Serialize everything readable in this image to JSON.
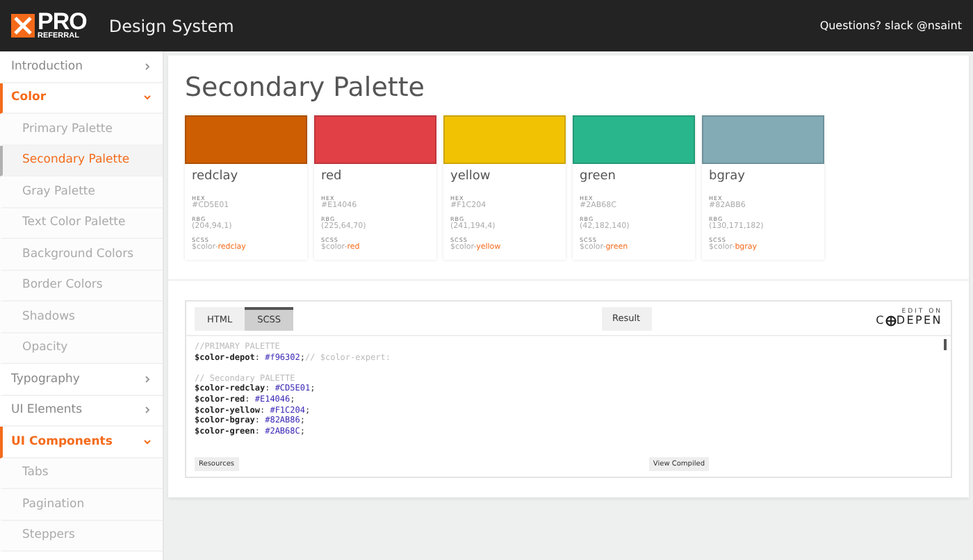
{
  "header": {
    "logo_top": "PRO",
    "logo_bottom": "REFERRAL",
    "title": "Design System",
    "contact": "Questions? slack @nsaint"
  },
  "sidebar": {
    "items": [
      {
        "kind": "section",
        "label": "Introduction",
        "expanded": false
      },
      {
        "kind": "section",
        "label": "Color",
        "expanded": true
      },
      {
        "kind": "sub",
        "label": "Primary Palette",
        "selected": false
      },
      {
        "kind": "sub",
        "label": "Secondary Palette",
        "selected": true
      },
      {
        "kind": "sub",
        "label": "Gray Palette",
        "selected": false
      },
      {
        "kind": "sub",
        "label": "Text Color Palette",
        "selected": false
      },
      {
        "kind": "sub",
        "label": "Background Colors",
        "selected": false
      },
      {
        "kind": "sub",
        "label": "Border Colors",
        "selected": false
      },
      {
        "kind": "sub",
        "label": "Shadows",
        "selected": false
      },
      {
        "kind": "sub",
        "label": "Opacity",
        "selected": false
      },
      {
        "kind": "section",
        "label": "Typography",
        "expanded": false
      },
      {
        "kind": "section",
        "label": "UI Elements",
        "expanded": false
      },
      {
        "kind": "section",
        "label": "UI Components",
        "expanded": true
      },
      {
        "kind": "sub",
        "label": "Tabs",
        "selected": false
      },
      {
        "kind": "sub",
        "label": "Pagination",
        "selected": false
      },
      {
        "kind": "sub",
        "label": "Steppers",
        "selected": false
      }
    ]
  },
  "page": {
    "title": "Secondary Palette",
    "swatches": [
      {
        "name": "redclay",
        "color": "#cd5e01",
        "hex_label": "HEX",
        "hex": "#CD5E01",
        "rgb_label": "RBG",
        "rgb": "(204,94,1)",
        "scss_label": "SCSS",
        "scss_prefix": "$color-",
        "scss_name": "redclay"
      },
      {
        "name": "red",
        "color": "#e14046",
        "hex_label": "HEX",
        "hex": "#E14046",
        "rgb_label": "RBG",
        "rgb": "(225,64,70)",
        "scss_label": "SCSS",
        "scss_prefix": "$color-",
        "scss_name": "red"
      },
      {
        "name": "yellow",
        "color": "#f1c204",
        "hex_label": "HEX",
        "hex": "#F1C204",
        "rgb_label": "RBG",
        "rgb": "(241,194,4)",
        "scss_label": "SCSS",
        "scss_prefix": "$color-",
        "scss_name": "yellow"
      },
      {
        "name": "green",
        "color": "#2ab68c",
        "hex_label": "HEX",
        "hex": "#2AB68C",
        "rgb_label": "RBG",
        "rgb": "(42,182,140)",
        "scss_label": "SCSS",
        "scss_prefix": "$color-",
        "scss_name": "green"
      },
      {
        "name": "bgray",
        "color": "#82abb6",
        "hex_label": "HEX",
        "hex": "#82ABB6",
        "rgb_label": "RBG",
        "rgb": "(130,171,182)",
        "scss_label": "SCSS",
        "scss_prefix": "$color-",
        "scss_name": "bgray"
      }
    ],
    "embed": {
      "tabs": [
        {
          "label": "HTML",
          "selected": false
        },
        {
          "label": "SCSS",
          "selected": true
        }
      ],
      "result_button": "Result",
      "edit_on": "EDIT ON",
      "brand_start": "C",
      "brand_end": "DEPEN",
      "code_blocks": [
        [
          [
            {
              "kind": "comment",
              "text": "//PRIMARY PALETTE"
            }
          ],
          [
            {
              "kind": "var",
              "text": "$color-depot"
            },
            {
              "kind": "plain",
              "text": ": "
            },
            {
              "kind": "value",
              "text": "#f96302"
            },
            {
              "kind": "plain",
              "text": ";"
            },
            {
              "kind": "comment",
              "text": "// $color-expert:"
            }
          ]
        ],
        [
          [
            {
              "kind": "comment",
              "text": "// Secondary PALETTE"
            }
          ],
          [
            {
              "kind": "var",
              "text": "$color-redclay"
            },
            {
              "kind": "plain",
              "text": ": "
            },
            {
              "kind": "value",
              "text": "#CD5E01"
            },
            {
              "kind": "plain",
              "text": ";"
            }
          ],
          [
            {
              "kind": "var",
              "text": "$color-red"
            },
            {
              "kind": "plain",
              "text": ": "
            },
            {
              "kind": "value",
              "text": "#E14046"
            },
            {
              "kind": "plain",
              "text": ";"
            }
          ],
          [
            {
              "kind": "var",
              "text": "$color-yellow"
            },
            {
              "kind": "plain",
              "text": ": "
            },
            {
              "kind": "value",
              "text": "#F1C204"
            },
            {
              "kind": "plain",
              "text": ";"
            }
          ],
          [
            {
              "kind": "var",
              "text": "$color-bgray"
            },
            {
              "kind": "plain",
              "text": ": "
            },
            {
              "kind": "value",
              "text": "#82AB86"
            },
            {
              "kind": "plain",
              "text": ";"
            }
          ],
          [
            {
              "kind": "var",
              "text": "$color-green"
            },
            {
              "kind": "plain",
              "text": ": "
            },
            {
              "kind": "value",
              "text": "#2AB68C"
            },
            {
              "kind": "plain",
              "text": ";"
            }
          ]
        ]
      ],
      "resources_button": "Resources",
      "compiled_button": "View Compiled"
    }
  }
}
